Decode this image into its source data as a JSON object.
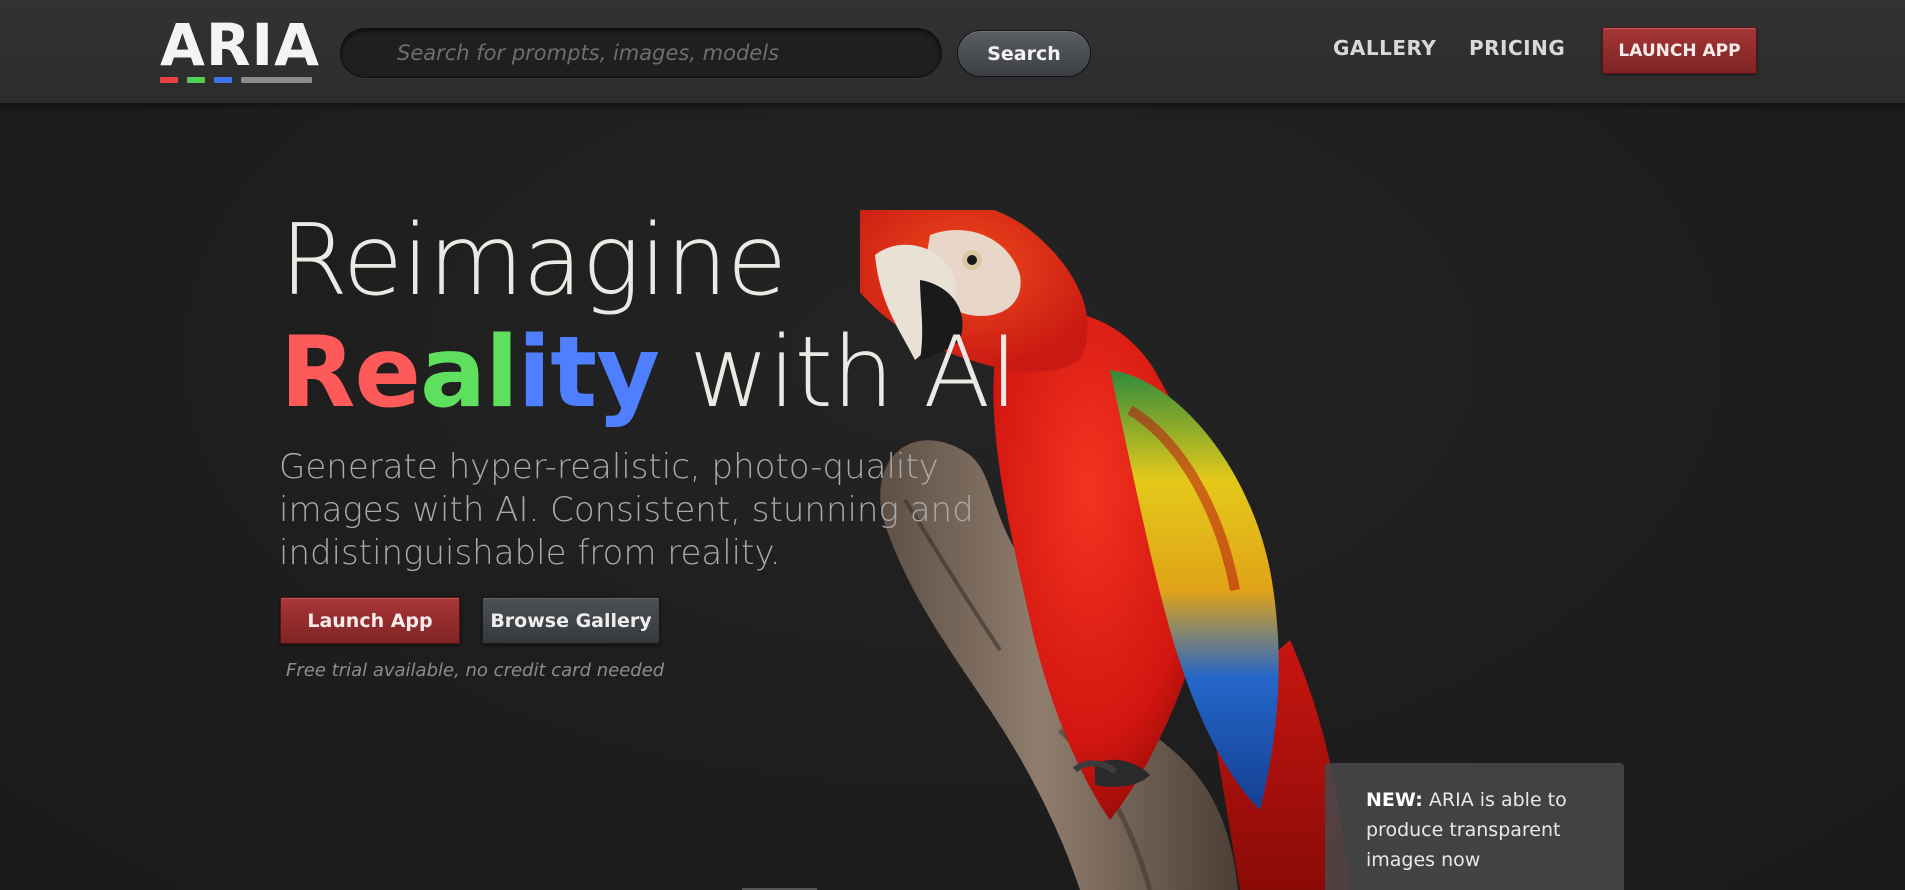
{
  "brand": {
    "logo_text": "ARIA",
    "logo_colors": [
      "#e94040",
      "#4fd24f",
      "#3d72e8",
      "#8a8a8a"
    ]
  },
  "header": {
    "search_placeholder": "Search for prompts, images, models",
    "search_button": "Search",
    "nav": {
      "gallery": "GALLERY",
      "pricing": "PRICING",
      "launch_app": "LAUNCH APP"
    }
  },
  "hero": {
    "headline_line1": "Reimagine",
    "headline_reality": [
      "R",
      "e",
      "a",
      "l",
      "i",
      "t",
      "y"
    ],
    "headline_rest": " with AI",
    "subheadline": "Generate hyper-realistic, photo-quality images with AI. Consistent, stunning and indistinguishable from reality.",
    "primary_button": "Launch App",
    "secondary_button": "Browse Gallery",
    "note": "Free trial available, no credit card needed"
  },
  "notice": {
    "label": "NEW:",
    "text": " ARIA is able to produce transparent images now"
  },
  "colors": {
    "accent_red": "#a63636",
    "reality_red": "#ff5a5a",
    "reality_green": "#5ee05e",
    "reality_blue": "#4f7fff"
  }
}
